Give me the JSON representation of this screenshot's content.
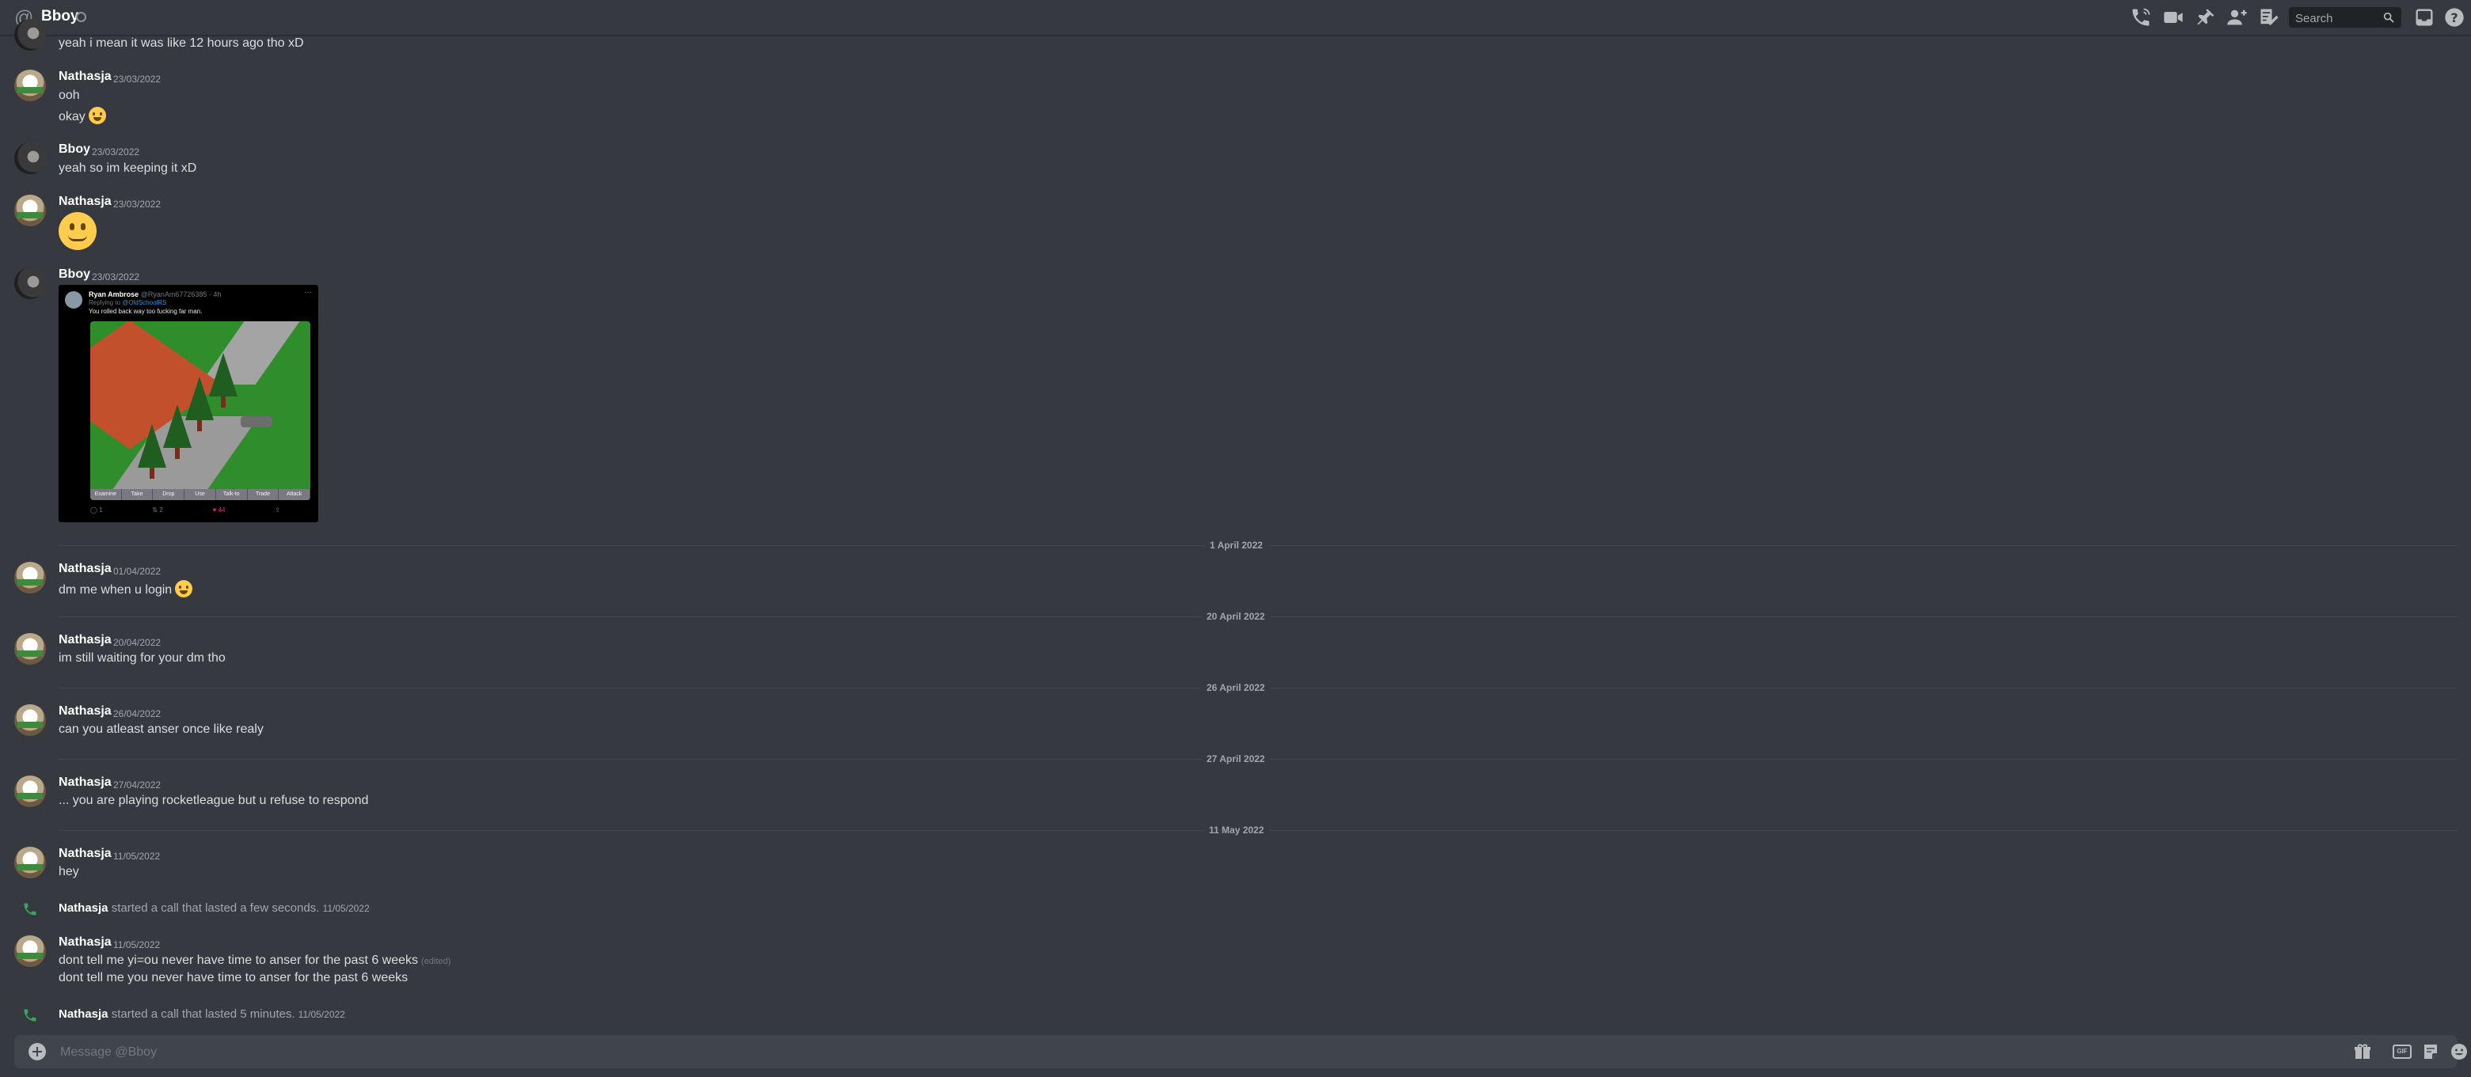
{
  "header": {
    "title": "Bboy",
    "search_placeholder": "Search",
    "icons": [
      "phone-call-icon",
      "video-call-icon",
      "pin-icon",
      "add-friend-icon",
      "edit-dm-icon",
      "search-icon",
      "inbox-icon",
      "help-icon"
    ]
  },
  "messages": [
    {
      "author": "",
      "timestamp": "",
      "lines": [
        "yeah i mean it was like 12 hours ago tho xD"
      ]
    },
    {
      "author": "Nathasja",
      "timestamp": "23/03/2022",
      "lines": [
        "ooh",
        "okay"
      ]
    },
    {
      "author": "Bboy",
      "timestamp": "23/03/2022",
      "lines": [
        "yeah so im keeping it xD"
      ]
    },
    {
      "author": "Nathasja",
      "timestamp": "23/03/2022",
      "lines": []
    },
    {
      "author": "Bboy",
      "timestamp": "23/03/2022",
      "lines": []
    },
    {
      "author": "Nathasja",
      "timestamp": "01/04/2022",
      "lines": [
        "dm me when u login"
      ]
    },
    {
      "author": "Nathasja",
      "timestamp": "20/04/2022",
      "lines": [
        "im still waiting for your dm tho"
      ]
    },
    {
      "author": "Nathasja",
      "timestamp": "26/04/2022",
      "lines": [
        "can you atleast anser once like realy"
      ]
    },
    {
      "author": "Nathasja",
      "timestamp": "27/04/2022",
      "lines": [
        "... you are playing rocketleague but u refuse to respond"
      ]
    },
    {
      "author": "Nathasja",
      "timestamp": "11/05/2022",
      "lines": [
        "hey"
      ]
    },
    {
      "author": "Nathasja",
      "timestamp": "11/05/2022",
      "lines": [
        "dont tell me yi=ou never have time to anser for the past 6 weeks",
        "dont tell me you never have time to anser for the past 6 weeks"
      ],
      "edited_label": "(edited)"
    }
  ],
  "dividers": [
    "1 April 2022",
    "20 April 2022",
    "26 April 2022",
    "27 April 2022",
    "11 May 2022"
  ],
  "calls": [
    {
      "author": "Nathasja",
      "text": "started a call that lasted a few seconds.",
      "timestamp": "11/05/2022"
    },
    {
      "author": "Nathasja",
      "text": "started a call that lasted 5 minutes.",
      "timestamp": "11/05/2022"
    }
  ],
  "tweet": {
    "name": "Ryan Ambrose",
    "handle": "@RyanAm67726385 · 4h",
    "replying_prefix": "Replying to",
    "replying_to": "@OldSchoolRS",
    "text": "You rolled back way too fucking far man.",
    "game_actions": [
      "Examine",
      "Take",
      "Drop",
      "Use",
      "Talk-to",
      "Trade",
      "Attack"
    ],
    "stats": {
      "replies": "1",
      "retweets": "2",
      "likes": "44"
    }
  },
  "composer": {
    "placeholder": "Message @Bboy",
    "gif_label": "GIF",
    "icons": [
      "add-attachment-icon",
      "gift-icon",
      "gif-icon",
      "sticker-icon",
      "emoji-icon"
    ]
  }
}
